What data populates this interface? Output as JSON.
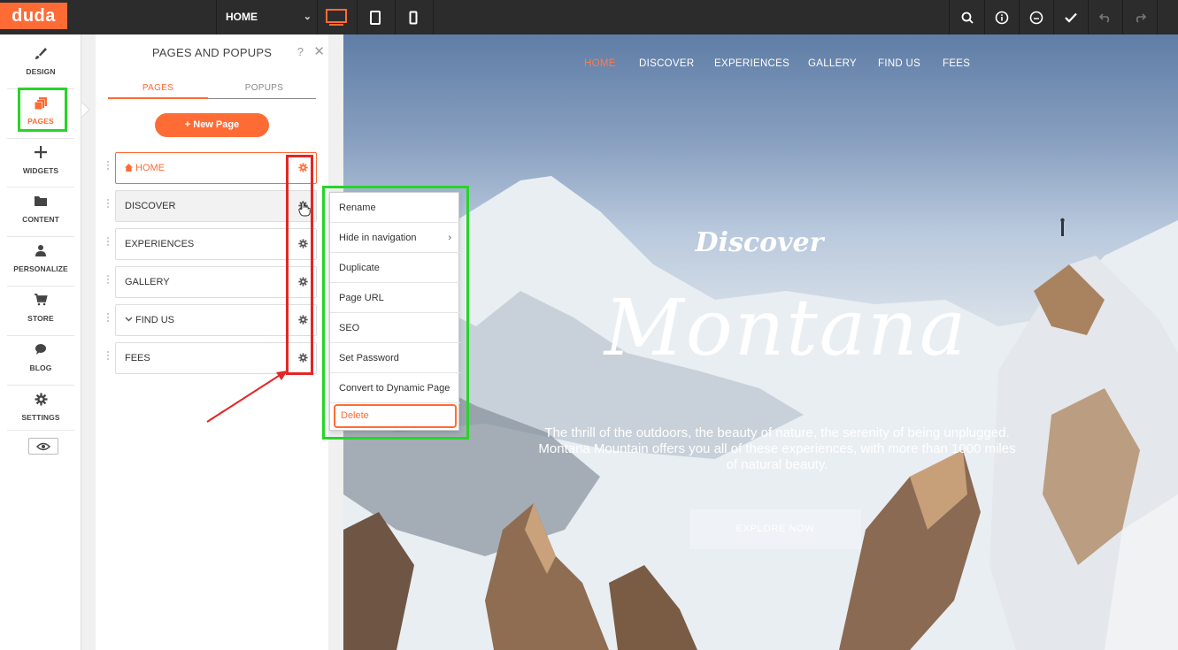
{
  "topbar": {
    "logo": "duda",
    "page_select": "HOME",
    "page_select_chevron": "⌄",
    "device_buttons": [
      "desktop-icon",
      "tablet-icon",
      "mobile-icon"
    ],
    "tools": [
      "search-icon",
      "info-icon",
      "comment-icon",
      "check-icon",
      "undo-icon",
      "redo-icon"
    ],
    "accent": "#ff6b35"
  },
  "leftnav": {
    "items": [
      {
        "label": "DESIGN",
        "icon": "brush-icon"
      },
      {
        "label": "PAGES",
        "icon": "pages-icon",
        "active": true
      },
      {
        "label": "WIDGETS",
        "icon": "plus-icon"
      },
      {
        "label": "CONTENT",
        "icon": "folder-icon"
      },
      {
        "label": "PERSONALIZE",
        "icon": "person-icon"
      },
      {
        "label": "STORE",
        "icon": "cart-icon"
      },
      {
        "label": "BLOG",
        "icon": "chat-bubble-icon"
      },
      {
        "label": "SETTINGS",
        "icon": "gear-icon"
      }
    ],
    "preview_icon": "eye-icon"
  },
  "panel": {
    "title": "PAGES AND POPUPS",
    "help": "?",
    "close": "✕",
    "tabs": [
      {
        "label": "PAGES",
        "active": true
      },
      {
        "label": "POPUPS"
      }
    ],
    "new_page": "+ New Page",
    "pages": [
      {
        "label": "HOME",
        "prefix": "home-icon"
      },
      {
        "label": "DISCOVER"
      },
      {
        "label": "EXPERIENCES"
      },
      {
        "label": "GALLERY"
      },
      {
        "label": "FIND US",
        "prefix": "chevron-down-icon"
      },
      {
        "label": "FEES"
      }
    ]
  },
  "site": {
    "nav": [
      "HOME",
      "DISCOVER",
      "EXPERIENCES",
      "GALLERY",
      "FIND US",
      "FEES"
    ],
    "subtitle": "Discover",
    "title": "Montana",
    "description": "The thrill of the outdoors, the beauty of nature, the serenity of being unplugged. Montana Mountain offers you all of these experiences, with more than 1000 miles of natural beauty.",
    "cta": "EXPLORE NOW"
  },
  "context_menu": {
    "items": [
      "Rename",
      "Hide in navigation",
      "Duplicate",
      "Page URL",
      "SEO",
      "Set Password",
      "Convert to Dynamic Page",
      "Delete"
    ],
    "submenu_arrow": "›"
  },
  "annotations": {
    "green": "#28d428",
    "red": "#e32626"
  }
}
